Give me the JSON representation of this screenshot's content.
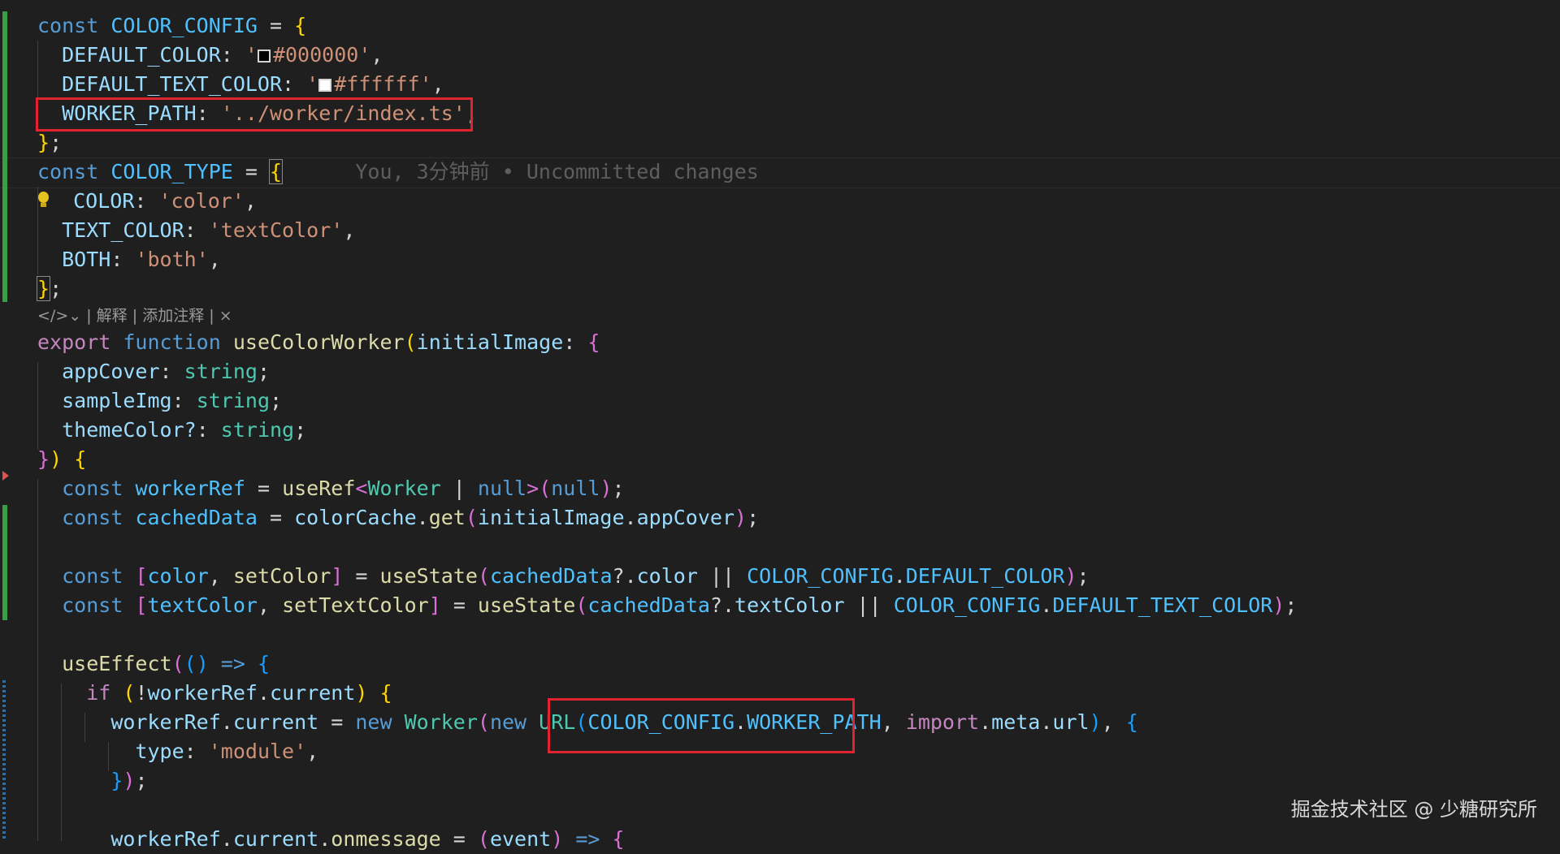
{
  "editor": {
    "code": {
      "l1": {
        "kw": "const",
        "name": "COLOR_CONFIG",
        "rest": " = ",
        "brace": "{"
      },
      "l2": {
        "key": "DEFAULT_COLOR",
        "colon": ": ",
        "q1": "'",
        "val": "#000000",
        "q2": "'",
        "end": ","
      },
      "l3": {
        "key": "DEFAULT_TEXT_COLOR",
        "colon": ": ",
        "q1": "'",
        "val": "#ffffff",
        "q2": "'",
        "end": ","
      },
      "l4": {
        "key": "WORKER_PATH",
        "colon": ": ",
        "val": "'../worker/index.ts'",
        "end": ","
      },
      "l5": {
        "brace": "}",
        "end": ";"
      },
      "l6": {
        "kw": "const",
        "name": "COLOR_TYPE",
        "rest": " = ",
        "brace": "{"
      },
      "l7": {
        "key": "COLOR",
        "colon": ": ",
        "val": "'color'",
        "end": ","
      },
      "l8": {
        "key": "TEXT_COLOR",
        "colon": ": ",
        "val": "'textColor'",
        "end": ","
      },
      "l9": {
        "key": "BOTH",
        "colon": ": ",
        "val": "'both'",
        "end": ","
      },
      "l10": {
        "brace": "}",
        "end": ";"
      },
      "l11": {
        "kw1": "export",
        "kw2": "function",
        "fn": "useColorWorker",
        "p": "(",
        "arg": "initialImage",
        "colon": ": ",
        "brace": "{"
      },
      "l12": {
        "key": "appCover",
        "colon": ": ",
        "type": "string",
        "end": ";"
      },
      "l13": {
        "key": "sampleImg",
        "colon": ": ",
        "type": "string",
        "end": ";"
      },
      "l14": {
        "key": "themeColor?",
        "colon": ": ",
        "type": "string",
        "end": ";"
      },
      "l15": {
        "brace": "}",
        "paren": ")",
        "sp": " ",
        "brace2": "{"
      },
      "l16": {
        "kw": "const",
        "var": "workerRef",
        "eq": " = ",
        "fn": "useRef",
        "lt": "<",
        "type": "Worker",
        "bar": " | ",
        "null1": "null",
        "gt": ">",
        "p1": "(",
        "null2": "null",
        "p2": ")",
        "end": ";"
      },
      "l17": {
        "kw": "const",
        "var": "cachedData",
        "eq": " = ",
        "obj": "colorCache",
        "dot": ".",
        "fn": "get",
        "p1": "(",
        "arg": "initialImage",
        "dot2": ".",
        "prop": "appCover",
        "p2": ")",
        "end": ";"
      },
      "l19": {
        "kw": "const",
        "b1": "[",
        "v1": "color",
        "comma": ", ",
        "v2": "setColor",
        "b2": "]",
        "eq": " = ",
        "fn": "useState",
        "p1": "(",
        "obj": "cachedData",
        "op": "?.",
        "prop": "color",
        "or": " || ",
        "cst": "COLOR_CONFIG",
        "dot": ".",
        "cst2": "DEFAULT_COLOR",
        "p2": ")",
        "end": ";"
      },
      "l20": {
        "kw": "const",
        "b1": "[",
        "v1": "textColor",
        "comma": ", ",
        "v2": "setTextColor",
        "b2": "]",
        "eq": " = ",
        "fn": "useState",
        "p1": "(",
        "obj": "cachedData",
        "op": "?.",
        "prop": "textColor",
        "or": " || ",
        "cst": "COLOR_CONFIG",
        "dot": ".",
        "cst2": "DEFAULT_TEXT_COLOR",
        "p2": ")",
        "end": ";"
      },
      "l22": {
        "fn": "useEffect",
        "p1": "(",
        "p2": "()",
        "arrow": " => ",
        "brace": "{"
      },
      "l23": {
        "kw": "if",
        "sp": " ",
        "p1": "(",
        "bang": "!",
        "obj": "workerRef",
        "dot": ".",
        "prop": "current",
        "p2": ")",
        "sp2": " ",
        "brace": "{"
      },
      "l24": {
        "obj": "workerRef",
        "dot": ".",
        "prop": "current",
        "eq": " = ",
        "kw": "new",
        "sp": " ",
        "cls": "Worker",
        "p1": "(",
        "kw2": "new",
        "sp2": " ",
        "cls2": "URL",
        "p2": "(",
        "cst": "COLOR_CONFIG",
        "dot2": ".",
        "cst2": "WORKER_PATH",
        "comma": ", ",
        "kw3": "import",
        "dot3": ".",
        "meta": "meta",
        "dot4": ".",
        "url": "url",
        "p3": ")",
        "comma2": ", ",
        "brace": "{"
      },
      "l25": {
        "key": "type",
        "colon": ": ",
        "val": "'module'",
        "end": ","
      },
      "l26": {
        "brace": "}",
        "p": ")",
        "end": ";"
      },
      "l28": {
        "obj": "workerRef",
        "dot": ".",
        "prop": "current",
        "dot2": ".",
        "prop2": "onmessage",
        "eq": " = ",
        "p1": "(",
        "arg": "event",
        "p2": ")",
        "arrow": " => ",
        "brace": "{"
      }
    },
    "blame": "You, 3分钟前 • Uncommitted changes",
    "codelens": {
      "explain": "解释",
      "add_comment": "添加注释",
      "close": "×",
      "sep": "|"
    }
  },
  "icons": {
    "codelens": "code-icon",
    "lightbulb": "lightbulb-icon",
    "breakpoint": "breakpoint-arrow-icon"
  },
  "colors": {
    "swatch_black": "#000000",
    "swatch_white": "#ffffff",
    "highlight_box": "#e0232e"
  },
  "watermark": "掘金技术社区 @ 少糖研究所"
}
